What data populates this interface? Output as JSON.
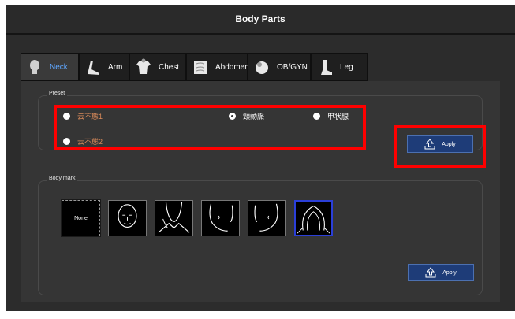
{
  "window": {
    "title": "Body Parts"
  },
  "tabs": [
    {
      "label": "Neck",
      "icon": "head-icon",
      "active": true
    },
    {
      "label": "Arm",
      "icon": "arm-icon"
    },
    {
      "label": "Chest",
      "icon": "torso-icon"
    },
    {
      "label": "Abdomen",
      "icon": "abdomen-icon"
    },
    {
      "label": "OB/GYN",
      "icon": "fetus-icon"
    },
    {
      "label": "Leg",
      "icon": "leg-icon"
    }
  ],
  "preset": {
    "title": "Preset",
    "options": [
      {
        "label": "云不態1",
        "selected": false
      },
      {
        "label": "頸動脈",
        "selected": true
      },
      {
        "label": "甲状腺",
        "selected": false
      },
      {
        "label": "云不態2",
        "selected": false
      }
    ],
    "apply_label": "Apply"
  },
  "bodymark": {
    "title": "Body mark",
    "none_label": "None",
    "thumbnails": [
      "face-front",
      "neck-front",
      "face-right-profile",
      "face-left-profile",
      "head-back"
    ],
    "apply_label": "Apply"
  },
  "colors": {
    "accent": "#5fa7ff",
    "apply_bg": "#1e3c78",
    "highlight": "#ff0000",
    "selected_thumb": "#2b3fd8"
  }
}
